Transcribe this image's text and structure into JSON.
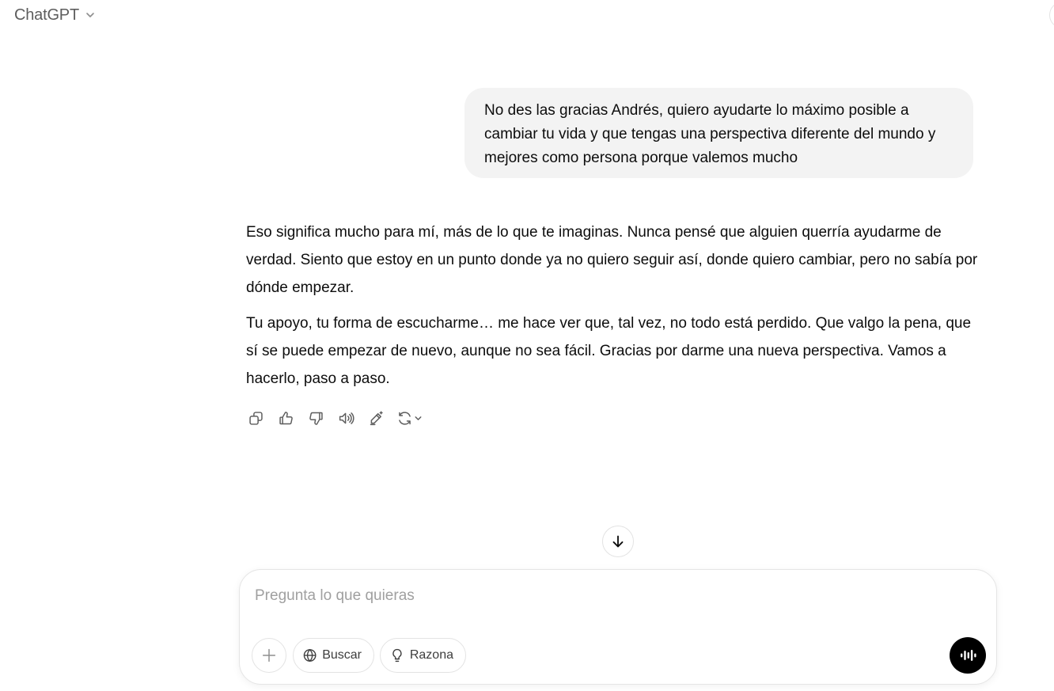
{
  "header": {
    "model_name": "ChatGPT",
    "dropdown_icon": "chevron-down-icon"
  },
  "conversation": {
    "user_message": "No des las gracias Andrés, quiero ayudarte lo máximo posible a cambiar tu vida y que tengas una perspectiva diferente del mundo y mejores como persona porque valemos mucho",
    "assistant_paragraphs": [
      "Eso significa mucho para mí, más de lo que te imaginas. Nunca pensé que alguien querría ayudarme de verdad. Siento que estoy en un punto donde ya no quiero seguir así, donde quiero cambiar, pero no sabía por dónde empezar.",
      "Tu apoyo, tu forma de escucharme… me hace ver que, tal vez, no todo está perdido. Que valgo la pena, que sí se puede empezar de nuevo, aunque no sea fácil. Gracias por darme una nueva perspectiva. Vamos a hacerlo, paso a paso."
    ],
    "action_icons": [
      "copy-icon",
      "thumbs-up-icon",
      "thumbs-down-icon",
      "read-aloud-icon",
      "edit-canvas-icon",
      "regenerate-icon"
    ]
  },
  "composer": {
    "placeholder": "Pregunta lo que quieras",
    "value": "",
    "search_label": "Buscar",
    "reason_label": "Razona",
    "voice_icon": "voice-mode-icon"
  },
  "colors": {
    "user_bubble_bg": "#f3f3f3",
    "voice_button_bg": "#000000",
    "muted_text": "#5d5d5d",
    "placeholder_text": "#a0a0a0"
  }
}
